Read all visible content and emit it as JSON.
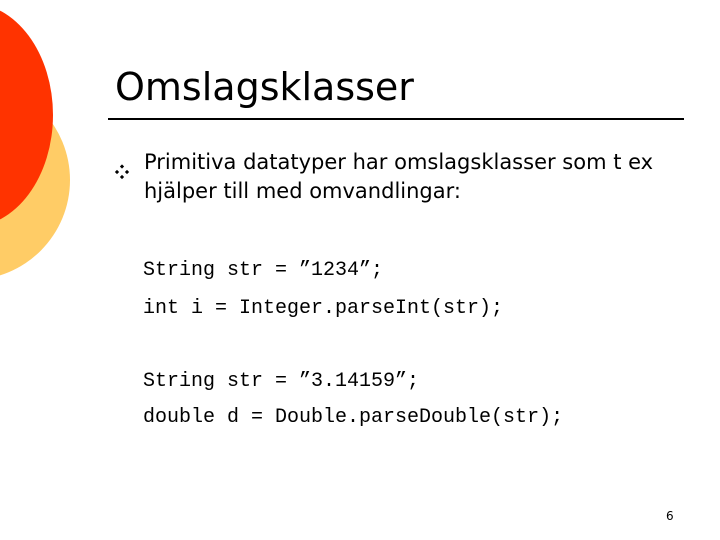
{
  "slide": {
    "title": "Omslagsklasser",
    "bullet_icon": "four-diamond-bullet-icon",
    "bullet_text": "Primitiva datatyper har omslagsklasser som t ex hjälper till med omvandlingar:",
    "code_lines": [
      "String str = ”1234”;",
      "int i = Integer.parseInt(str);",
      "String str = ”3.14159”;",
      "double d = Double.parseDouble(str);"
    ],
    "page_number": "6"
  },
  "colors": {
    "circle_red": "#FF3300",
    "circle_orange": "#FFCC66",
    "text": "#000000"
  }
}
